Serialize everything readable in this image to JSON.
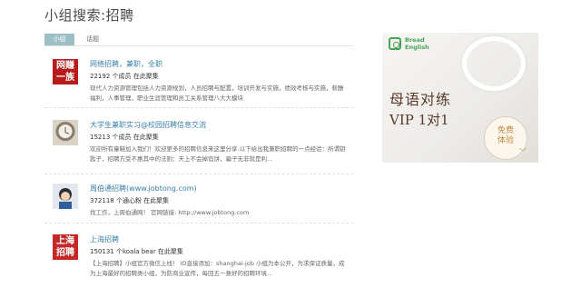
{
  "page": {
    "title": "小组搜索:招聘"
  },
  "tabs": [
    {
      "label": "小组",
      "active": true
    },
    {
      "label": "话题",
      "active": false
    }
  ],
  "groups": [
    {
      "avatar_text": "网赚\n一族",
      "name": "网络招聘，兼职，全职",
      "members": "22192 个成员 在此聚集",
      "desc": "现代人力资源管理包括人力资源规划，人员招聘与配置，培训开发与实施，绩效考核与实施，薪酬福利，人事管理，职业生涯管理和员工关系管理八大大模块"
    },
    {
      "avatar_text": "",
      "name": "大学生兼职实习@校园招聘信息交流",
      "members": "15213 个成员 在此聚集",
      "desc": "欢迎所有童鞋加入我们！欢迎更多的招聘信息来这里分享.以下给出我兼职招聘的一点经验：所谓钥匙子，招聘方受不惠其中的法则：天上不会掉馅饼，骗子无非就是利..."
    },
    {
      "avatar_text": "",
      "name": "周伯通招聘(www.jobtong.com)",
      "members": "372118 个通心粉 在此聚集",
      "desc": "找工作，上周伯通网！ 官网链接: http://www.jobtong.com"
    },
    {
      "avatar_text": "上海\n招聘",
      "name": "上海招聘",
      "members": "150131 个koala bear 在此聚集",
      "desc": "【上海招聘】小组官方微信上线！ ID直接添加：shanghai-job 小组为本公开，为求保证质量，成为上海最好的招聘类小组，为防商业宣传，每回五一意好的招聘环境..."
    }
  ],
  "ad": {
    "brand_line1": "Bread",
    "brand_line2": "English",
    "line1": "母语对练",
    "line2": "VIP 1对1",
    "badge_line1": "免费",
    "badge_line2": "体验",
    "chevron": "﹀"
  }
}
